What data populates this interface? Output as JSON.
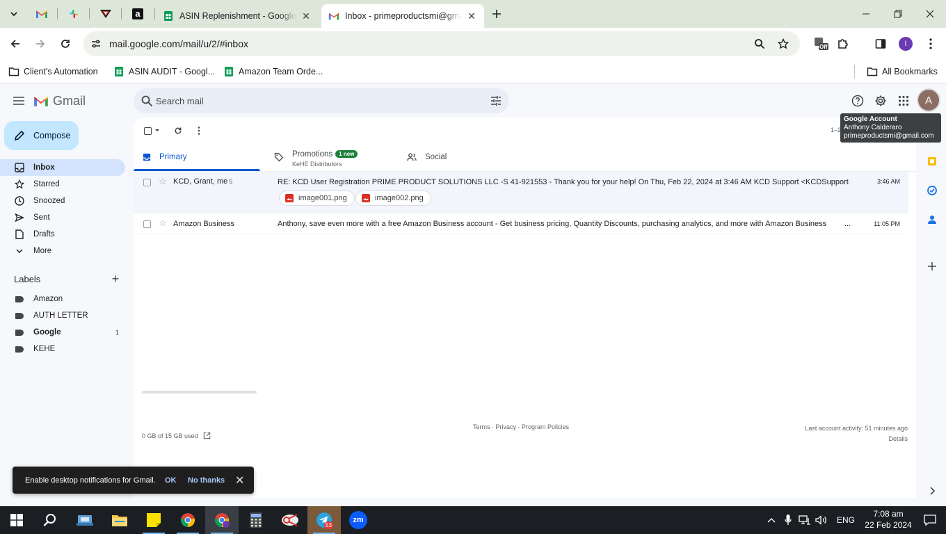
{
  "browser": {
    "tabs": [
      {
        "title": "ASIN Replenishment - Google S",
        "icon": "sheets-icon"
      },
      {
        "title": "Inbox - primeproductsmi@gma",
        "icon": "gmail-icon",
        "active": true
      }
    ],
    "pinned_icons": [
      "gmail-icon",
      "slack-icon",
      "app-icon",
      "amazon-icon"
    ],
    "url": "mail.google.com/mail/u/2/#inbox",
    "extension_badge": "off",
    "profile_initial": "I",
    "bookmarks": [
      {
        "label": "Client's Automation",
        "icon": "folder-icon"
      },
      {
        "label": "ASIN AUDIT - Googl...",
        "icon": "sheets-icon"
      },
      {
        "label": "Amazon Team Orde...",
        "icon": "sheets-icon"
      }
    ],
    "all_bookmarks": "All Bookmarks"
  },
  "gmail": {
    "brand": "Gmail",
    "search_placeholder": "Search mail",
    "avatar_initial": "A",
    "tooltip": {
      "title": "Google Account",
      "name": "Anthony Calderaro",
      "email": "primeproductsmi@gmail.com"
    },
    "compose": "Compose",
    "nav": [
      {
        "label": "Inbox",
        "icon": "inbox-icon",
        "active": true
      },
      {
        "label": "Starred",
        "icon": "star-icon"
      },
      {
        "label": "Snoozed",
        "icon": "clock-icon"
      },
      {
        "label": "Sent",
        "icon": "send-icon"
      },
      {
        "label": "Drafts",
        "icon": "draft-icon"
      },
      {
        "label": "More",
        "icon": "chevron-down-icon"
      }
    ],
    "labels_heading": "Labels",
    "labels": [
      {
        "label": "Amazon",
        "count": ""
      },
      {
        "label": "AUTH LETTER",
        "count": ""
      },
      {
        "label": "Google",
        "count": "1",
        "bold": true
      },
      {
        "label": "KEHE",
        "count": ""
      }
    ],
    "range_text": "1–2",
    "tabs": {
      "primary": "Primary",
      "promotions": "Promotions",
      "promotions_badge": "1 new",
      "promotions_sub": "KeHE Distributors",
      "social": "Social"
    },
    "emails": [
      {
        "sender": "KCD, Grant, me",
        "count": "5",
        "subject": "RE: KCD User Registration PRIME PRODUCT SOLUTIONS LLC -S 41-921553 - Thank you for your help! On Thu, Feb 22, 2024 at 3:46 AM KCD Support <KCDSupport@kehe.co...",
        "time": "3:46 AM",
        "attachments": [
          "image001.png",
          "image002.png"
        ]
      },
      {
        "sender": "Amazon Business",
        "count": "",
        "subject": "Anthony, save even more with a free Amazon Business account - Get business pricing, Quantity Discounts, purchasing analytics, and more with Amazon Business",
        "ellipsis": "...",
        "time": "11:05 PM",
        "attachments": []
      }
    ],
    "storage": "0 GB of 15 GB used",
    "footer": {
      "terms": "Terms",
      "privacy": "Privacy",
      "policies": "Program Policies",
      "sep": " · "
    },
    "activity": "Last account activity: 51 minutes ago",
    "details": "Details",
    "snackbar": {
      "text": "Enable desktop notifications for Gmail.",
      "ok": "OK",
      "no": "No thanks"
    }
  },
  "taskbar": {
    "apps": [
      "windows-start-icon",
      "search-icon",
      "file-manager-icon",
      "file-explorer-icon",
      "sticky-notes-icon",
      "chrome-icon",
      "chrome-profile-icon",
      "calculator-icon",
      "snipping-tool-icon",
      "telegram-icon",
      "zoom-icon"
    ],
    "telegram_badge": "53",
    "language": "ENG",
    "time": "7:08 am",
    "date": "22 Feb 2024"
  },
  "colors": {
    "accent": "#0b57d0",
    "compose_bg": "#c2e7ff",
    "active_nav": "#d3e3fd",
    "promo_badge": "#188038"
  }
}
